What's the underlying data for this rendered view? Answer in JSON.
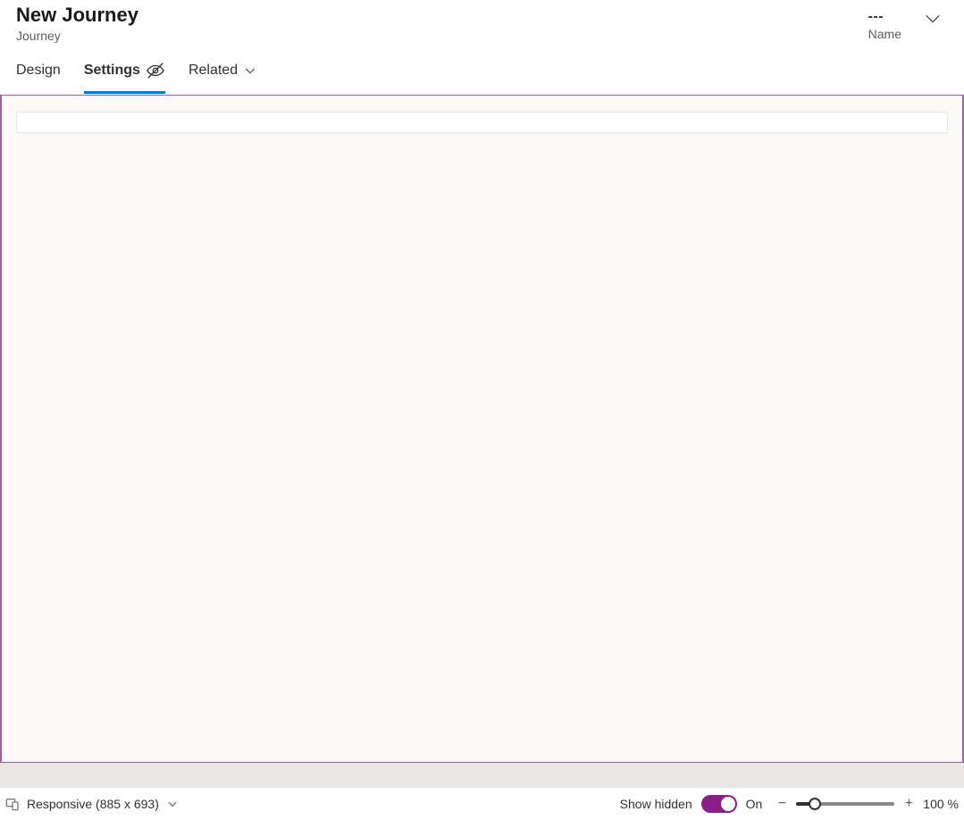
{
  "header": {
    "title": "New Journey",
    "subtitle": "Journey",
    "name_value": "---",
    "name_label": "Name"
  },
  "tabs": {
    "design": "Design",
    "settings": "Settings",
    "related": "Related"
  },
  "footer": {
    "responsive_label": "Responsive (885 x 693)",
    "show_hidden_label": "Show hidden",
    "toggle_state": "On",
    "zoom_text": "100 %"
  }
}
